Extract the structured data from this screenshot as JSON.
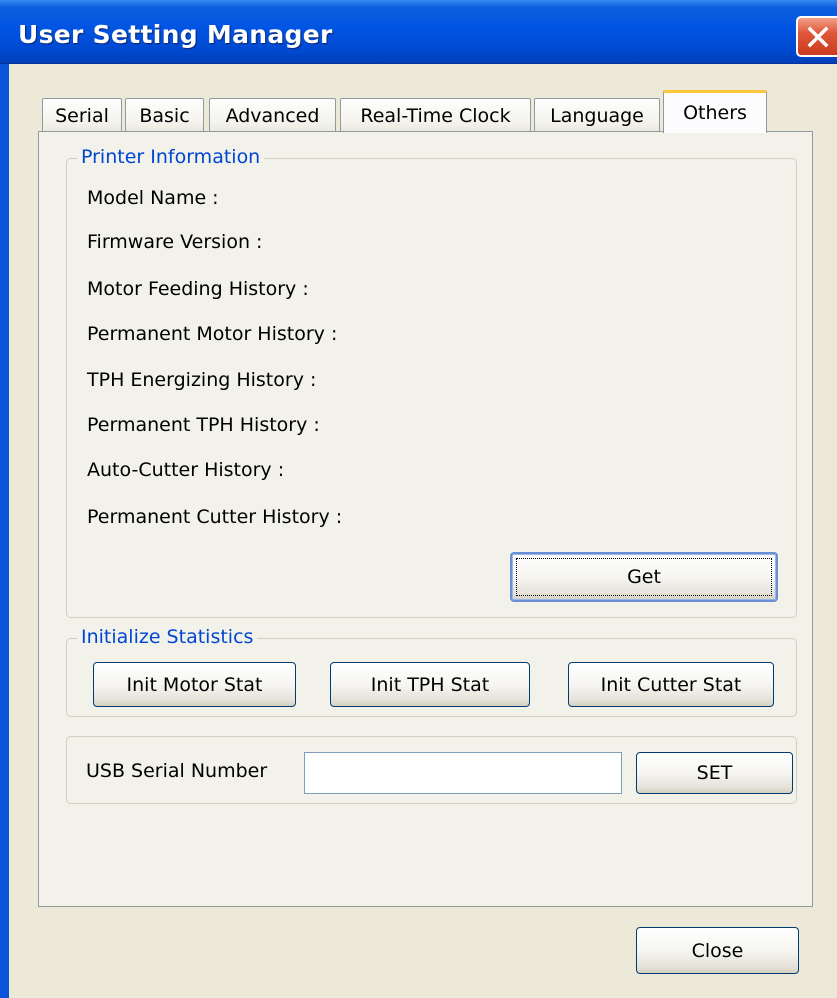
{
  "window": {
    "title": "User Setting Manager"
  },
  "tabs": [
    {
      "label": "Serial",
      "active": false
    },
    {
      "label": "Basic",
      "active": false
    },
    {
      "label": "Advanced",
      "active": false
    },
    {
      "label": "Real-Time Clock",
      "active": false
    },
    {
      "label": "Language",
      "active": false
    },
    {
      "label": "Others",
      "active": true
    }
  ],
  "printer_info": {
    "legend": "Printer Information",
    "fields": [
      {
        "label": "Model Name :"
      },
      {
        "label": "Firmware Version :"
      },
      {
        "label": "Motor Feeding History :"
      },
      {
        "label": "Permanent Motor History :"
      },
      {
        "label": "TPH Energizing History :"
      },
      {
        "label": "Permanent TPH History :"
      },
      {
        "label": "Auto-Cutter History :"
      },
      {
        "label": "Permanent Cutter History :"
      }
    ],
    "get_label": "Get"
  },
  "init_stats": {
    "legend": "Initialize Statistics",
    "motor_label": "Init Motor Stat",
    "tph_label": "Init TPH Stat",
    "cutter_label": "Init Cutter Stat"
  },
  "usb": {
    "label": "USB Serial Number",
    "value": "",
    "set_label": "SET"
  },
  "footer": {
    "close_label": "Close"
  },
  "icons": {
    "close": "close-icon"
  },
  "colors": {
    "titlebar": "#0054e3",
    "legend_text": "#0046d5",
    "active_tab_accent": "#ffc83c",
    "close_button": "#cc3a1e"
  }
}
